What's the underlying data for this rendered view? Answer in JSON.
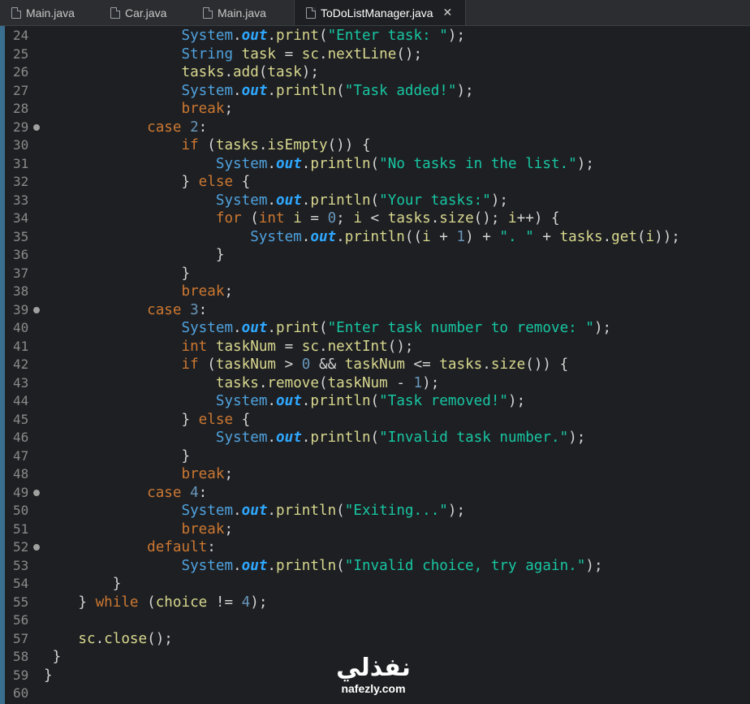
{
  "tabs": [
    {
      "label": "Main.java",
      "active": false
    },
    {
      "label": "Car.java",
      "active": false
    },
    {
      "label": "Main.java",
      "active": false
    },
    {
      "label": "ToDoListManager.java",
      "active": true
    }
  ],
  "close_glyph": "✕",
  "colors": {
    "keyword": "#cc7832",
    "type": "#4fa3e0",
    "static_field": "#2ea8ff",
    "string": "#17c6a3",
    "number": "#6897bb",
    "identifier": "#d8d88f",
    "background": "#1e1f22"
  },
  "lines": [
    {
      "n": "24",
      "fold": false,
      "tokens": [
        [
          "op",
          "                "
        ],
        [
          "ty",
          "System"
        ],
        [
          "op",
          "."
        ],
        [
          "fld",
          "out"
        ],
        [
          "op",
          "."
        ],
        [
          "id",
          "print"
        ],
        [
          "op",
          "("
        ],
        [
          "str",
          "\"Enter task: \""
        ],
        [
          "op",
          ");"
        ]
      ]
    },
    {
      "n": "25",
      "fold": false,
      "tokens": [
        [
          "op",
          "                "
        ],
        [
          "ty",
          "String"
        ],
        [
          "op",
          " "
        ],
        [
          "id",
          "task"
        ],
        [
          "op",
          " = "
        ],
        [
          "id",
          "sc"
        ],
        [
          "op",
          "."
        ],
        [
          "id",
          "nextLine"
        ],
        [
          "op",
          "();"
        ]
      ]
    },
    {
      "n": "26",
      "fold": false,
      "tokens": [
        [
          "op",
          "                "
        ],
        [
          "id",
          "tasks"
        ],
        [
          "op",
          "."
        ],
        [
          "id",
          "add"
        ],
        [
          "op",
          "("
        ],
        [
          "id",
          "task"
        ],
        [
          "op",
          ");"
        ]
      ]
    },
    {
      "n": "27",
      "fold": false,
      "tokens": [
        [
          "op",
          "                "
        ],
        [
          "ty",
          "System"
        ],
        [
          "op",
          "."
        ],
        [
          "fld",
          "out"
        ],
        [
          "op",
          "."
        ],
        [
          "id",
          "println"
        ],
        [
          "op",
          "("
        ],
        [
          "str",
          "\"Task added!\""
        ],
        [
          "op",
          ");"
        ]
      ]
    },
    {
      "n": "28",
      "fold": false,
      "tokens": [
        [
          "op",
          "                "
        ],
        [
          "kw",
          "break"
        ],
        [
          "op",
          ";"
        ]
      ]
    },
    {
      "n": "29",
      "fold": true,
      "tokens": [
        [
          "op",
          "            "
        ],
        [
          "kw",
          "case"
        ],
        [
          "op",
          " "
        ],
        [
          "num",
          "2"
        ],
        [
          "op",
          ":"
        ]
      ]
    },
    {
      "n": "30",
      "fold": false,
      "tokens": [
        [
          "op",
          "                "
        ],
        [
          "kw",
          "if"
        ],
        [
          "op",
          " ("
        ],
        [
          "id",
          "tasks"
        ],
        [
          "op",
          "."
        ],
        [
          "id",
          "isEmpty"
        ],
        [
          "op",
          "()) {"
        ]
      ]
    },
    {
      "n": "31",
      "fold": false,
      "tokens": [
        [
          "op",
          "                    "
        ],
        [
          "ty",
          "System"
        ],
        [
          "op",
          "."
        ],
        [
          "fld",
          "out"
        ],
        [
          "op",
          "."
        ],
        [
          "id",
          "println"
        ],
        [
          "op",
          "("
        ],
        [
          "str",
          "\"No tasks in the list.\""
        ],
        [
          "op",
          ");"
        ]
      ]
    },
    {
      "n": "32",
      "fold": false,
      "tokens": [
        [
          "op",
          "                } "
        ],
        [
          "kw",
          "else"
        ],
        [
          "op",
          " {"
        ]
      ]
    },
    {
      "n": "33",
      "fold": false,
      "tokens": [
        [
          "op",
          "                    "
        ],
        [
          "ty",
          "System"
        ],
        [
          "op",
          "."
        ],
        [
          "fld",
          "out"
        ],
        [
          "op",
          "."
        ],
        [
          "id",
          "println"
        ],
        [
          "op",
          "("
        ],
        [
          "str",
          "\"Your tasks:\""
        ],
        [
          "op",
          ");"
        ]
      ]
    },
    {
      "n": "34",
      "fold": false,
      "tokens": [
        [
          "op",
          "                    "
        ],
        [
          "kw",
          "for"
        ],
        [
          "op",
          " ("
        ],
        [
          "kw",
          "int"
        ],
        [
          "op",
          " "
        ],
        [
          "id",
          "i"
        ],
        [
          "op",
          " = "
        ],
        [
          "num",
          "0"
        ],
        [
          "op",
          "; "
        ],
        [
          "id",
          "i"
        ],
        [
          "op",
          " < "
        ],
        [
          "id",
          "tasks"
        ],
        [
          "op",
          "."
        ],
        [
          "id",
          "size"
        ],
        [
          "op",
          "(); "
        ],
        [
          "id",
          "i"
        ],
        [
          "op",
          "++) {"
        ]
      ]
    },
    {
      "n": "35",
      "fold": false,
      "tokens": [
        [
          "op",
          "                        "
        ],
        [
          "ty",
          "System"
        ],
        [
          "op",
          "."
        ],
        [
          "fld",
          "out"
        ],
        [
          "op",
          "."
        ],
        [
          "id",
          "println"
        ],
        [
          "op",
          "(("
        ],
        [
          "id",
          "i"
        ],
        [
          "op",
          " + "
        ],
        [
          "num",
          "1"
        ],
        [
          "op",
          ") + "
        ],
        [
          "str",
          "\". \""
        ],
        [
          "op",
          " + "
        ],
        [
          "id",
          "tasks"
        ],
        [
          "op",
          "."
        ],
        [
          "id",
          "get"
        ],
        [
          "op",
          "("
        ],
        [
          "id",
          "i"
        ],
        [
          "op",
          "));"
        ]
      ]
    },
    {
      "n": "36",
      "fold": false,
      "tokens": [
        [
          "op",
          "                    }"
        ]
      ]
    },
    {
      "n": "37",
      "fold": false,
      "tokens": [
        [
          "op",
          "                }"
        ]
      ]
    },
    {
      "n": "38",
      "fold": false,
      "tokens": [
        [
          "op",
          "                "
        ],
        [
          "kw",
          "break"
        ],
        [
          "op",
          ";"
        ]
      ]
    },
    {
      "n": "39",
      "fold": true,
      "tokens": [
        [
          "op",
          "            "
        ],
        [
          "kw",
          "case"
        ],
        [
          "op",
          " "
        ],
        [
          "num",
          "3"
        ],
        [
          "op",
          ":"
        ]
      ]
    },
    {
      "n": "40",
      "fold": false,
      "tokens": [
        [
          "op",
          "                "
        ],
        [
          "ty",
          "System"
        ],
        [
          "op",
          "."
        ],
        [
          "fld",
          "out"
        ],
        [
          "op",
          "."
        ],
        [
          "id",
          "print"
        ],
        [
          "op",
          "("
        ],
        [
          "str",
          "\"Enter task number to remove: \""
        ],
        [
          "op",
          ");"
        ]
      ]
    },
    {
      "n": "41",
      "fold": false,
      "tokens": [
        [
          "op",
          "                "
        ],
        [
          "kw",
          "int"
        ],
        [
          "op",
          " "
        ],
        [
          "id",
          "taskNum"
        ],
        [
          "op",
          " = "
        ],
        [
          "id",
          "sc"
        ],
        [
          "op",
          "."
        ],
        [
          "id",
          "nextInt"
        ],
        [
          "op",
          "();"
        ]
      ]
    },
    {
      "n": "42",
      "fold": false,
      "tokens": [
        [
          "op",
          "                "
        ],
        [
          "kw",
          "if"
        ],
        [
          "op",
          " ("
        ],
        [
          "id",
          "taskNum"
        ],
        [
          "op",
          " > "
        ],
        [
          "num",
          "0"
        ],
        [
          "op",
          " && "
        ],
        [
          "id",
          "taskNum"
        ],
        [
          "op",
          " <= "
        ],
        [
          "id",
          "tasks"
        ],
        [
          "op",
          "."
        ],
        [
          "id",
          "size"
        ],
        [
          "op",
          "()) {"
        ]
      ]
    },
    {
      "n": "43",
      "fold": false,
      "tokens": [
        [
          "op",
          "                    "
        ],
        [
          "id",
          "tasks"
        ],
        [
          "op",
          "."
        ],
        [
          "id",
          "remove"
        ],
        [
          "op",
          "("
        ],
        [
          "id",
          "taskNum"
        ],
        [
          "op",
          " - "
        ],
        [
          "num",
          "1"
        ],
        [
          "op",
          ");"
        ]
      ]
    },
    {
      "n": "44",
      "fold": false,
      "tokens": [
        [
          "op",
          "                    "
        ],
        [
          "ty",
          "System"
        ],
        [
          "op",
          "."
        ],
        [
          "fld",
          "out"
        ],
        [
          "op",
          "."
        ],
        [
          "id",
          "println"
        ],
        [
          "op",
          "("
        ],
        [
          "str",
          "\"Task removed!\""
        ],
        [
          "op",
          ");"
        ]
      ]
    },
    {
      "n": "45",
      "fold": false,
      "tokens": [
        [
          "op",
          "                } "
        ],
        [
          "kw",
          "else"
        ],
        [
          "op",
          " {"
        ]
      ]
    },
    {
      "n": "46",
      "fold": false,
      "tokens": [
        [
          "op",
          "                    "
        ],
        [
          "ty",
          "System"
        ],
        [
          "op",
          "."
        ],
        [
          "fld",
          "out"
        ],
        [
          "op",
          "."
        ],
        [
          "id",
          "println"
        ],
        [
          "op",
          "("
        ],
        [
          "str",
          "\"Invalid task number.\""
        ],
        [
          "op",
          ");"
        ]
      ]
    },
    {
      "n": "47",
      "fold": false,
      "tokens": [
        [
          "op",
          "                }"
        ]
      ]
    },
    {
      "n": "48",
      "fold": false,
      "tokens": [
        [
          "op",
          "                "
        ],
        [
          "kw",
          "break"
        ],
        [
          "op",
          ";"
        ]
      ]
    },
    {
      "n": "49",
      "fold": true,
      "tokens": [
        [
          "op",
          "            "
        ],
        [
          "kw",
          "case"
        ],
        [
          "op",
          " "
        ],
        [
          "num",
          "4"
        ],
        [
          "op",
          ":"
        ]
      ]
    },
    {
      "n": "50",
      "fold": false,
      "tokens": [
        [
          "op",
          "                "
        ],
        [
          "ty",
          "System"
        ],
        [
          "op",
          "."
        ],
        [
          "fld",
          "out"
        ],
        [
          "op",
          "."
        ],
        [
          "id",
          "println"
        ],
        [
          "op",
          "("
        ],
        [
          "str",
          "\"Exiting...\""
        ],
        [
          "op",
          ");"
        ]
      ]
    },
    {
      "n": "51",
      "fold": false,
      "tokens": [
        [
          "op",
          "                "
        ],
        [
          "kw",
          "break"
        ],
        [
          "op",
          ";"
        ]
      ]
    },
    {
      "n": "52",
      "fold": true,
      "tokens": [
        [
          "op",
          "            "
        ],
        [
          "kw",
          "default"
        ],
        [
          "op",
          ":"
        ]
      ]
    },
    {
      "n": "53",
      "fold": false,
      "tokens": [
        [
          "op",
          "                "
        ],
        [
          "ty",
          "System"
        ],
        [
          "op",
          "."
        ],
        [
          "fld",
          "out"
        ],
        [
          "op",
          "."
        ],
        [
          "id",
          "println"
        ],
        [
          "op",
          "("
        ],
        [
          "str",
          "\"Invalid choice, try again.\""
        ],
        [
          "op",
          ");"
        ]
      ]
    },
    {
      "n": "54",
      "fold": false,
      "tokens": [
        [
          "op",
          "        }"
        ]
      ]
    },
    {
      "n": "55",
      "fold": false,
      "tokens": [
        [
          "op",
          "    } "
        ],
        [
          "kw",
          "while"
        ],
        [
          "op",
          " ("
        ],
        [
          "id",
          "choice"
        ],
        [
          "op",
          " != "
        ],
        [
          "num",
          "4"
        ],
        [
          "op",
          ");"
        ]
      ]
    },
    {
      "n": "56",
      "fold": false,
      "tokens": []
    },
    {
      "n": "57",
      "fold": false,
      "tokens": [
        [
          "op",
          "    "
        ],
        [
          "id",
          "sc"
        ],
        [
          "op",
          "."
        ],
        [
          "id",
          "close"
        ],
        [
          "op",
          "();"
        ]
      ]
    },
    {
      "n": "58",
      "fold": false,
      "tokens": [
        [
          "op",
          " }"
        ]
      ]
    },
    {
      "n": "59",
      "fold": false,
      "tokens": [
        [
          "op",
          "}"
        ]
      ]
    },
    {
      "n": "60",
      "fold": false,
      "tokens": []
    }
  ],
  "watermark": {
    "arabic": "نفذلي",
    "latin": "nafezly.com"
  }
}
